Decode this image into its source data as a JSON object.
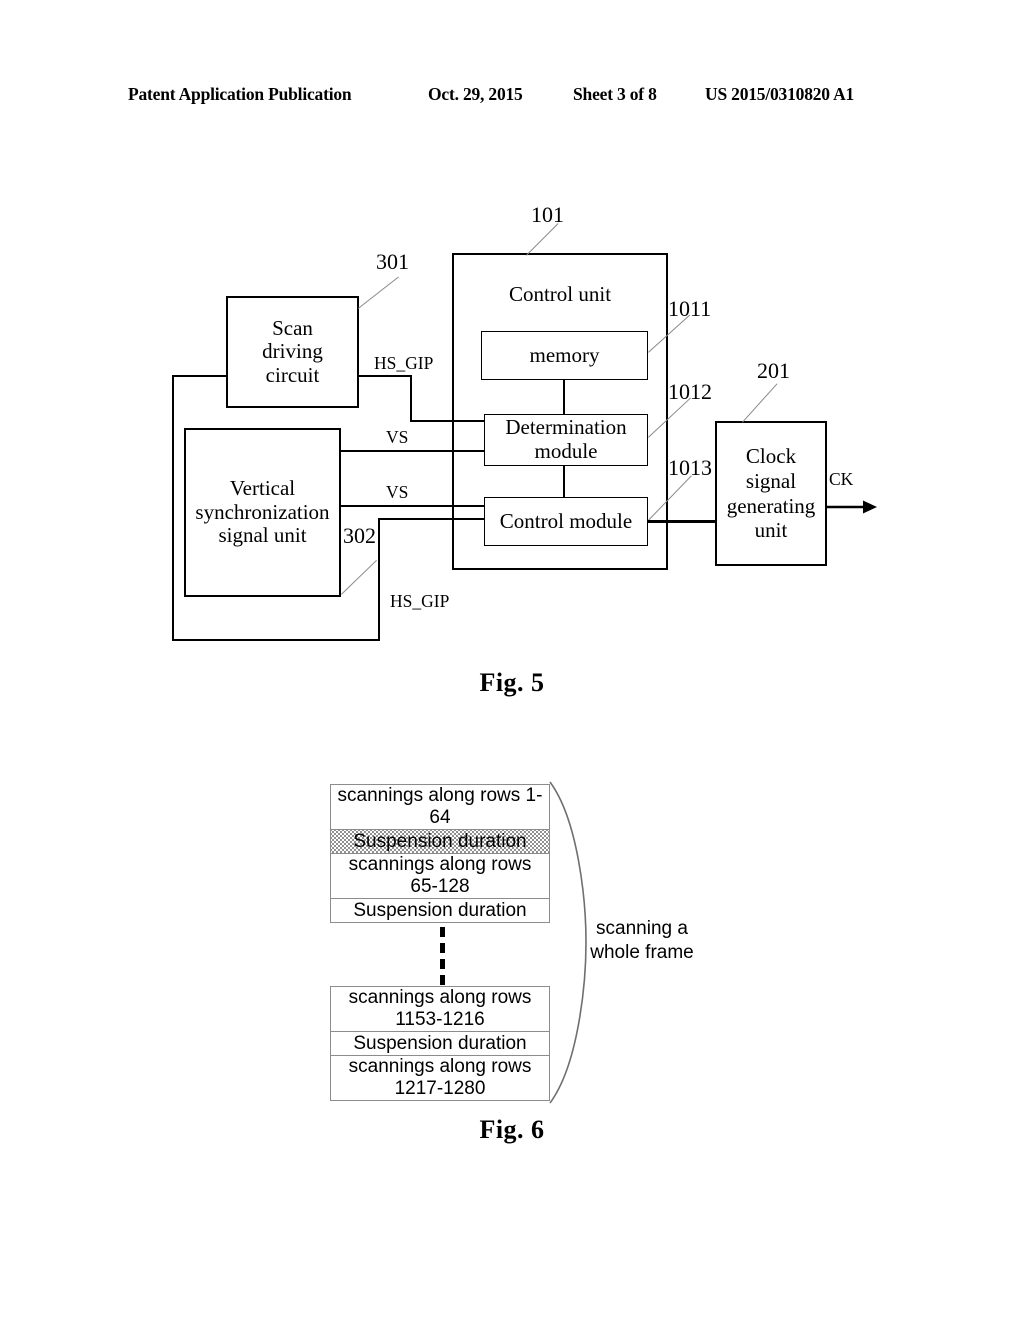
{
  "header": {
    "publication": "Patent Application Publication",
    "date": "Oct. 29, 2015",
    "sheet": "Sheet 3 of 8",
    "number": "US 2015/0310820 A1"
  },
  "fig5": {
    "caption": "Fig. 5",
    "blocks": {
      "scan_driving_circuit": "Scan driving circuit",
      "vertical_sync_unit": "Vertical synchronization signal unit",
      "control_unit": "Control unit",
      "memory": "memory",
      "determination_module": "Determination module",
      "control_module": "Control module",
      "clock_unit": "Clock signal generating unit"
    },
    "refs": {
      "scan_driving_circuit": "301",
      "vertical_sync_unit": "302",
      "control_unit": "101",
      "memory": "1011",
      "determination_module": "1012",
      "control_module": "1013",
      "clock_unit": "201"
    },
    "signals": {
      "hs_gip_top": "HS_GIP",
      "hs_gip_bottom": "HS_GIP",
      "vs_top": "VS",
      "vs_bottom": "VS",
      "ck": "CK"
    }
  },
  "fig6": {
    "caption": "Fig. 6",
    "note": "scanning a\nwhole frame",
    "group_top": [
      {
        "text": "scannings along rows 1-64",
        "stipple": false
      },
      {
        "text": "Suspension duration",
        "stipple": true
      },
      {
        "text": "scannings along rows 65-128",
        "stipple": false
      },
      {
        "text": "Suspension duration",
        "stipple": false
      }
    ],
    "group_bottom": [
      {
        "text": "scannings along rows 1153-1216",
        "stipple": false
      },
      {
        "text": "Suspension duration",
        "stipple": false
      },
      {
        "text": "scannings along rows 1217-1280",
        "stipple": false
      }
    ]
  }
}
